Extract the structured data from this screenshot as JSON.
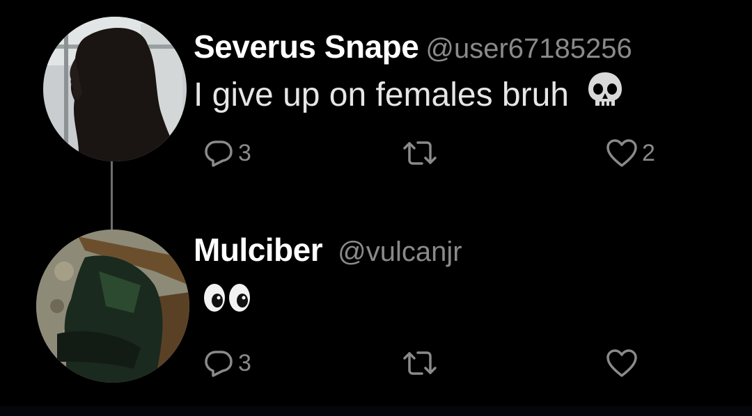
{
  "colors": {
    "background": "#000000",
    "name": "#ffffff",
    "handle": "#8a8a8a",
    "body": "#e6e6e6",
    "icons": "#8a8a8a",
    "thread_line": "#6e6e6e"
  },
  "tweets": [
    {
      "display_name": "Severus Snape",
      "handle": "@user67185256",
      "text": "I give up on females bruh",
      "emoji": "skull",
      "reply_count": "3",
      "retweet_count": "",
      "like_count": "2",
      "avatar": "profile-silhouette-photo"
    },
    {
      "display_name": "Mulciber",
      "handle": "@vulcanjr",
      "text": "",
      "emoji": "eyes",
      "reply_count": "3",
      "retweet_count": "",
      "like_count": "",
      "avatar": "person-in-chair-photo"
    }
  ]
}
